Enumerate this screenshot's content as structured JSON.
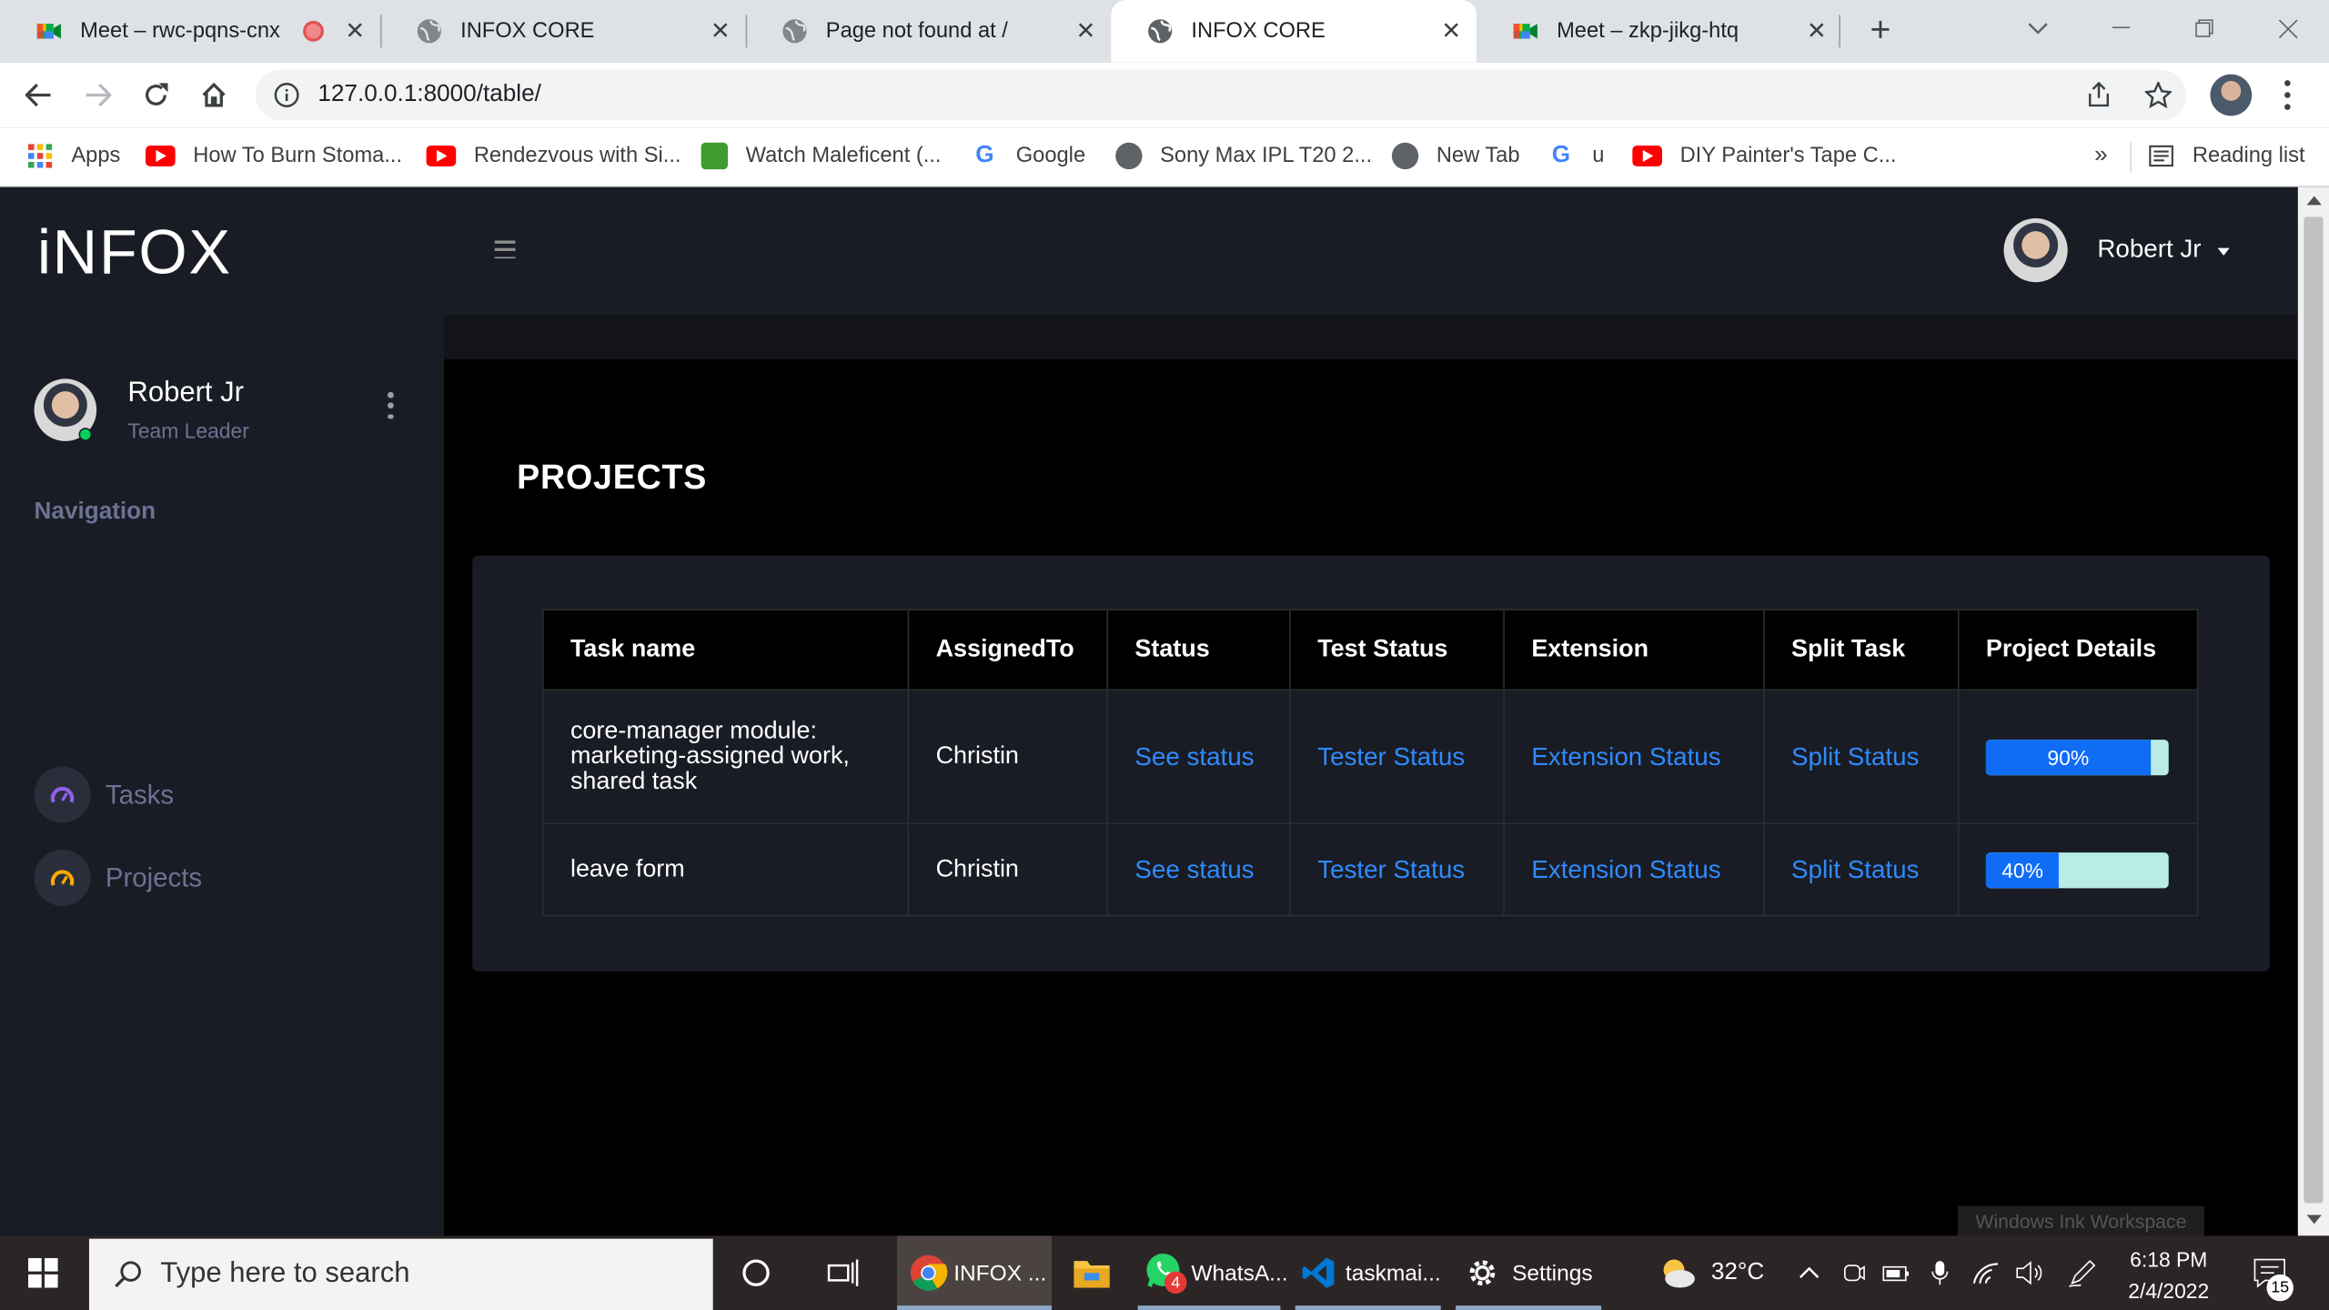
{
  "browser": {
    "tabs": [
      {
        "title": "Meet – rwc-pqns-cnx",
        "favicon": "google-meet-icon",
        "recording": true
      },
      {
        "title": "INFOX CORE",
        "favicon": "globe-icon"
      },
      {
        "title": "Page not found at /",
        "favicon": "globe-icon"
      },
      {
        "title": "INFOX CORE",
        "favicon": "globe-icon",
        "active": true
      },
      {
        "title": "Meet – zkp-jikg-htq",
        "favicon": "google-meet-icon"
      }
    ],
    "url": "127.0.0.1:8000/table/",
    "bookmarks": [
      {
        "label": "Apps",
        "icon": "apps-grid-icon"
      },
      {
        "label": "How To Burn Stoma...",
        "icon": "youtube-icon"
      },
      {
        "label": "Rendezvous with Si...",
        "icon": "youtube-icon"
      },
      {
        "label": "Watch Maleficent (...",
        "icon": "video-icon"
      },
      {
        "label": "Google",
        "icon": "google-icon"
      },
      {
        "label": "Sony Max IPL T20 2...",
        "icon": "globe-icon"
      },
      {
        "label": "New Tab",
        "icon": "globe-icon"
      },
      {
        "label": "u",
        "icon": "google-icon"
      },
      {
        "label": "DIY Painter's Tape C...",
        "icon": "youtube-icon"
      }
    ],
    "bookmarks_overflow": "»",
    "reading_list": "Reading list"
  },
  "app": {
    "brand": "iNFOX",
    "user": {
      "name": "Robert Jr",
      "role": "Team Leader"
    },
    "navigation_title": "Navigation",
    "nav_items": [
      {
        "label": "Tasks",
        "icon": "speedometer-icon",
        "color": "#8f5fe8"
      },
      {
        "label": "Projects",
        "icon": "speedometer-icon",
        "color": "#ffab00"
      }
    ],
    "page_title": "PROJECTS",
    "table": {
      "headers": [
        "Task name",
        "AssignedTo",
        "Status",
        "Test Status",
        "Extension",
        "Split Task",
        "Project Details"
      ],
      "rows": [
        {
          "task_name": "core-manager module: marketing-assigned work, shared task",
          "assigned_to": "Christin",
          "status": "See status",
          "test_status": "Tester Status",
          "extension": "Extension Status",
          "split": "Split Status",
          "progress": 90,
          "progress_label": "90%"
        },
        {
          "task_name": "leave form",
          "assigned_to": "Christin",
          "status": "See status",
          "test_status": "Tester Status",
          "extension": "Extension Status",
          "split": "Split Status",
          "progress": 40,
          "progress_label": "40%"
        }
      ]
    },
    "ink_hint": "Windows Ink Workspace"
  },
  "taskbar": {
    "search_placeholder": "Type here to search",
    "apps": [
      {
        "label": "INFOX ...",
        "icon": "chrome-icon"
      },
      {
        "label": "",
        "icon": "file-explorer-icon"
      },
      {
        "label": "WhatsA...",
        "icon": "whatsapp-icon",
        "badge": "4"
      },
      {
        "label": "taskmai...",
        "icon": "vscode-icon"
      },
      {
        "label": "Settings",
        "icon": "gear-icon"
      }
    ],
    "weather": "32°C",
    "time": "6:18 PM",
    "date": "2/4/2022",
    "notifications": "15"
  },
  "colors": {
    "accent_link": "#2f8bff",
    "sidebar_bg": "#191c24",
    "progress_fill": "#0f6cf5",
    "progress_track": "#b9ece7",
    "online": "#00d25b"
  }
}
